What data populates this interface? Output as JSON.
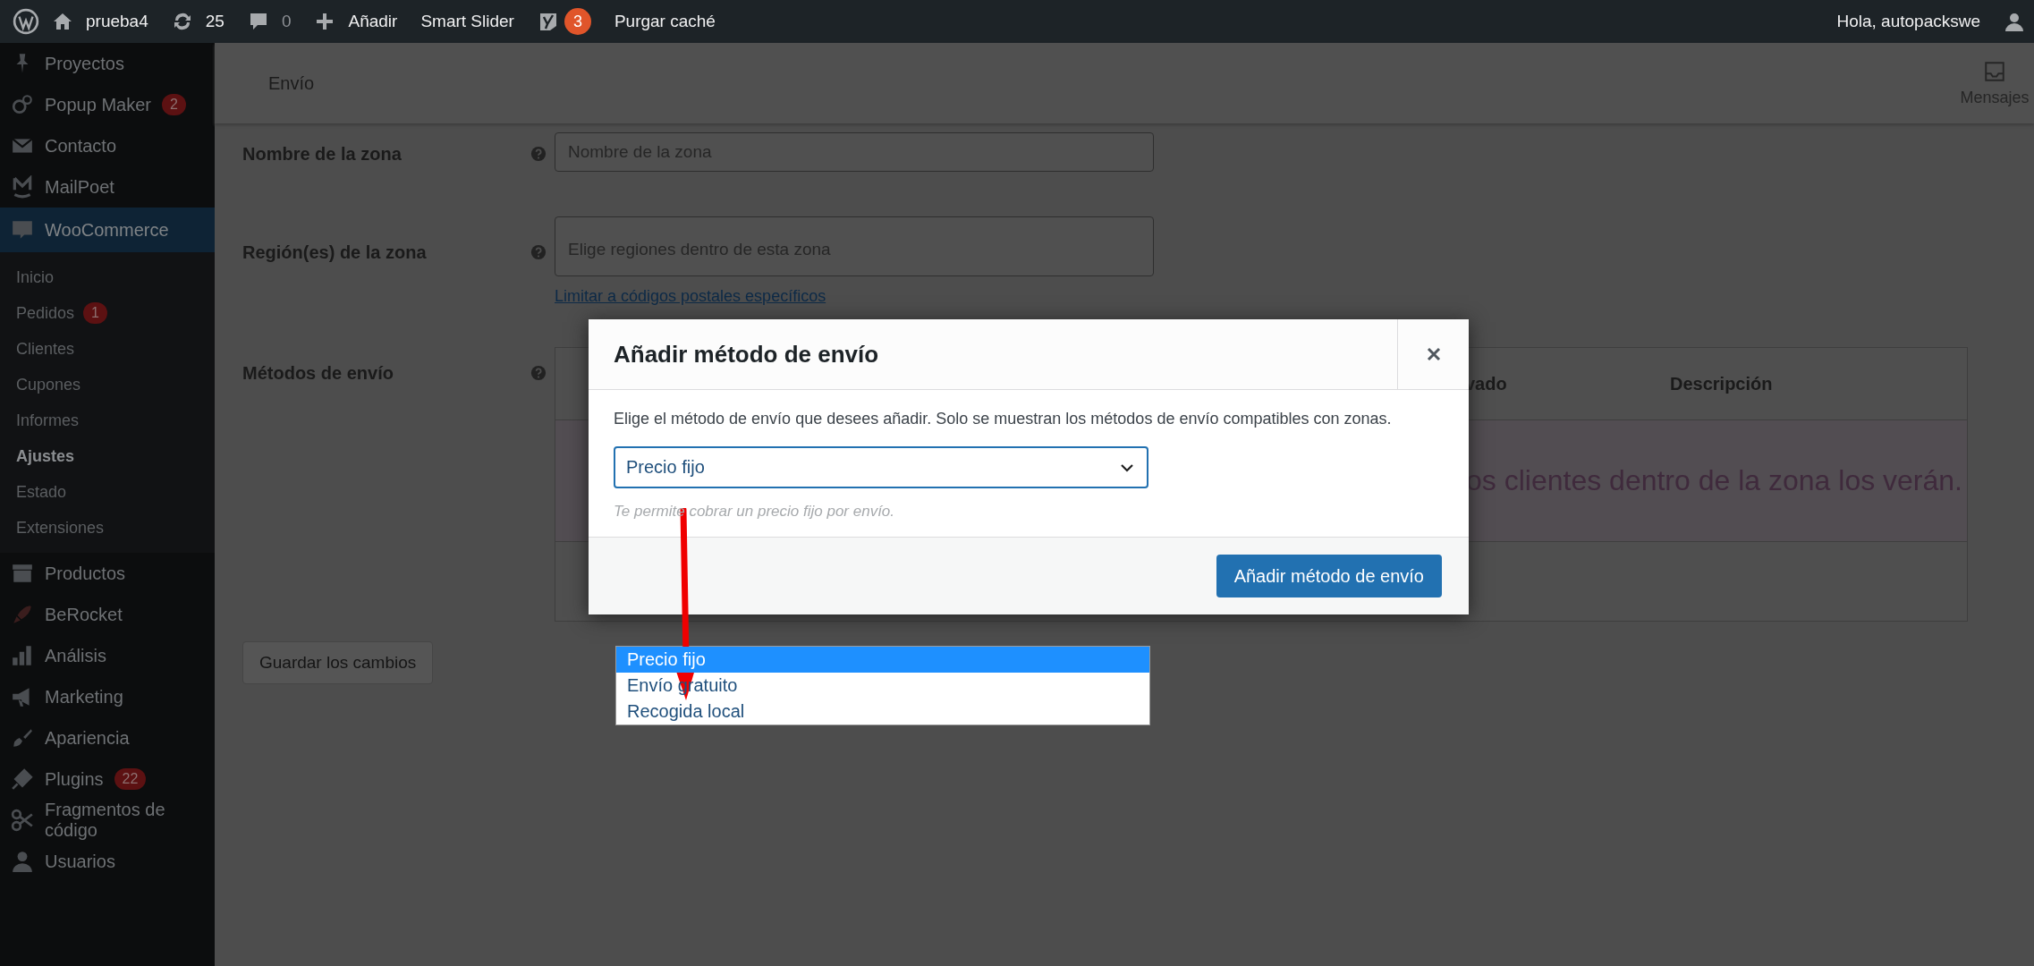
{
  "admin_bar": {
    "site": "prueba4",
    "updates": "25",
    "comments": "0",
    "new": "Añadir",
    "links": [
      "Smart Slider"
    ],
    "seo_badge": "3",
    "cache": "Purgar caché",
    "greeting": "Hola, autopackswe"
  },
  "sidebar": {
    "items": [
      {
        "label": "Proyectos",
        "selected": false
      },
      {
        "label": "Popup Maker",
        "badge": "2",
        "selected": false
      },
      {
        "label": "Contacto",
        "selected": false
      },
      {
        "label": "MailPoet",
        "selected": false
      },
      {
        "label": "WooCommerce",
        "selected": true,
        "children": [
          {
            "label": "Inicio",
            "selected": false
          },
          {
            "label": "Pedidos",
            "badge": "1",
            "selected": false
          },
          {
            "label": "Clientes",
            "selected": false
          },
          {
            "label": "Cupones",
            "selected": false
          },
          {
            "label": "Informes",
            "selected": false
          },
          {
            "label": "Ajustes",
            "selected": true
          },
          {
            "label": "Estado",
            "selected": false
          },
          {
            "label": "Extensiones",
            "selected": false
          }
        ]
      },
      {
        "label": "Productos",
        "selected": false
      },
      {
        "label": "BeRocket",
        "selected": false
      },
      {
        "label": "Análisis",
        "selected": false
      },
      {
        "label": "Marketing",
        "selected": false
      },
      {
        "label": "Apariencia",
        "selected": false
      },
      {
        "label": "Plugins",
        "badge": "22",
        "selected": false
      },
      {
        "label": "Fragmentos de código",
        "selected": false
      },
      {
        "label": "Usuarios",
        "selected": false
      }
    ]
  },
  "header": {
    "title": "Envío",
    "inbox": "Mensajes"
  },
  "form": {
    "fields": [
      {
        "label": "Nombre de la zona",
        "placeholder": "Nombre de la zona"
      },
      {
        "label": "Región(es) de la zona",
        "placeholder": "Elige regiones dentro de esta zona",
        "link": "Limitar a códigos postales específicos"
      }
    ],
    "methods_label": "Métodos de envío",
    "table": {
      "columns": [
        "vado",
        "Descripción"
      ],
      "empty_text": "os clientes dentro de la zona los verán."
    },
    "save_button": {
      "label": "Guardar los cambios",
      "disabled": true
    }
  },
  "modal": {
    "title": "Añadir método de envío",
    "text": "Elige el método de envío que desees añadir. Solo se muestran los métodos de envío compatibles con zonas.",
    "select": {
      "value": "Precio fijo",
      "options": [
        {
          "label": "Precio fijo",
          "selected": true
        },
        {
          "label": "Envío gratuito",
          "selected": false
        },
        {
          "label": "Recogida local",
          "selected": false
        }
      ]
    },
    "hint": "Te permite cobrar un precio fijo por envío.",
    "button": "Añadir método de envío"
  }
}
